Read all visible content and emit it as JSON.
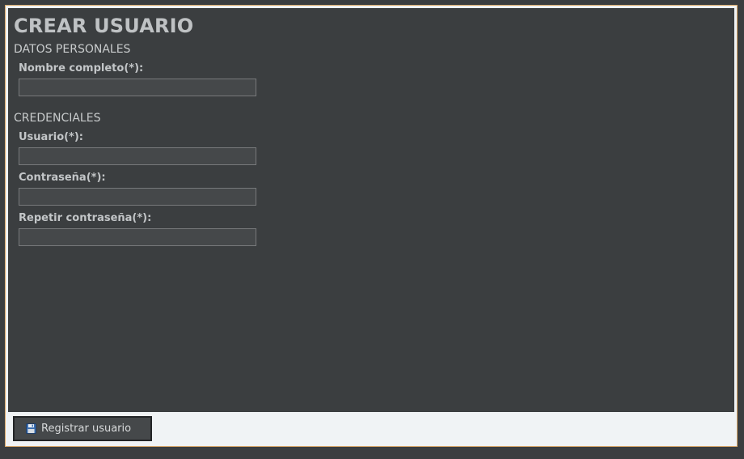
{
  "form": {
    "title": "CREAR USUARIO",
    "sections": [
      {
        "heading": "DATOS PERSONALES",
        "fields": [
          {
            "label": "Nombre completo(*):",
            "value": ""
          }
        ]
      },
      {
        "heading": "CREDENCIALES",
        "fields": [
          {
            "label": "Usuario(*):",
            "value": ""
          },
          {
            "label": "Contraseña(*):",
            "value": ""
          },
          {
            "label": "Repetir contraseña(*):",
            "value": ""
          }
        ]
      }
    ],
    "submit": {
      "label": "Registrar usuario",
      "icon": "save-icon"
    }
  },
  "colors": {
    "background": "#3b3e40",
    "frame_border": "#d9a86a",
    "footer_background": "#f0f3f5",
    "input_background": "#45484a",
    "text": "#c3c6c8"
  }
}
